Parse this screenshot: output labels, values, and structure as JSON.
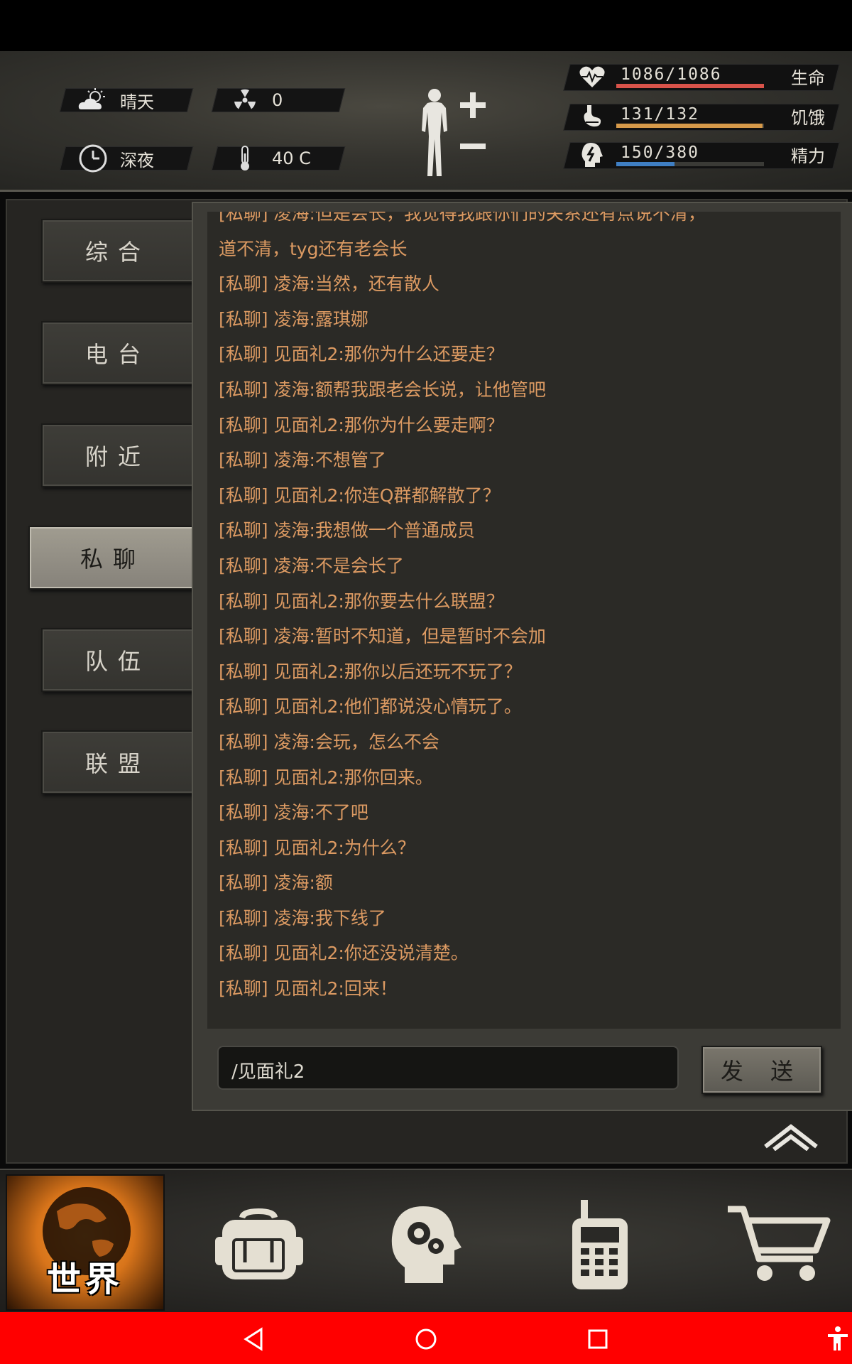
{
  "hud": {
    "weather": "晴天",
    "radiation": "0",
    "time_of_day": "深夜",
    "temperature": "40 C",
    "stats": [
      {
        "value": "1086/1086",
        "label": "生命",
        "fraction": 1.0,
        "color": "#d9534a",
        "icon": "heart-pulse-icon"
      },
      {
        "value": "131/132",
        "label": "饥饿",
        "fraction": 0.99,
        "color": "#d79a4a",
        "icon": "stomach-icon"
      },
      {
        "value": "150/380",
        "label": "精力",
        "fraction": 0.395,
        "color": "#3f7fc4",
        "icon": "head-energy-icon"
      }
    ]
  },
  "tabs": [
    {
      "label": "综合",
      "active": false
    },
    {
      "label": "电台",
      "active": false
    },
    {
      "label": "附近",
      "active": false
    },
    {
      "label": "私聊",
      "active": true
    },
    {
      "label": "队伍",
      "active": false
    },
    {
      "label": "联盟",
      "active": false
    }
  ],
  "chat": {
    "partial_top": "[私聊] 凌海:但是会长，我觉得我跟你们的关系还有点说不清，",
    "messages": [
      "道不清，tyg还有老会长",
      "[私聊] 凌海:当然，还有散人",
      "[私聊] 凌海:露琪娜",
      "[私聊] 见面礼2:那你为什么还要走？",
      "[私聊] 凌海:额帮我跟老会长说，让他管吧",
      "[私聊] 见面礼2:那你为什么要走啊？",
      "[私聊] 凌海:不想管了",
      "[私聊] 见面礼2:你连Q群都解散了？",
      "[私聊] 凌海:我想做一个普通成员",
      "[私聊] 凌海:不是会长了",
      "[私聊] 见面礼2:那你要去什么联盟？",
      "[私聊] 凌海:暂时不知道，但是暂时不会加",
      "[私聊] 见面礼2:那你以后还玩不玩了？",
      "[私聊] 见面礼2:他们都说没心情玩了。",
      "[私聊] 凌海:会玩，怎么不会",
      "[私聊] 见面礼2:那你回来。",
      "[私聊] 凌海:不了吧",
      "[私聊] 见面礼2:为什么？",
      "[私聊] 凌海:额",
      "[私聊] 凌海:我下线了",
      "[私聊] 见面礼2:你还没说清楚。",
      "[私聊] 见面礼2:回来！"
    ],
    "input_value": "/见面礼2",
    "send_label": "发 送"
  },
  "dock": {
    "world_label": "世界",
    "items": [
      "backpack-icon",
      "skills-head-icon",
      "radio-icon",
      "shop-cart-icon"
    ]
  },
  "navbar": {
    "items": [
      "back-icon",
      "home-icon",
      "recents-icon",
      "accessibility-icon"
    ]
  }
}
